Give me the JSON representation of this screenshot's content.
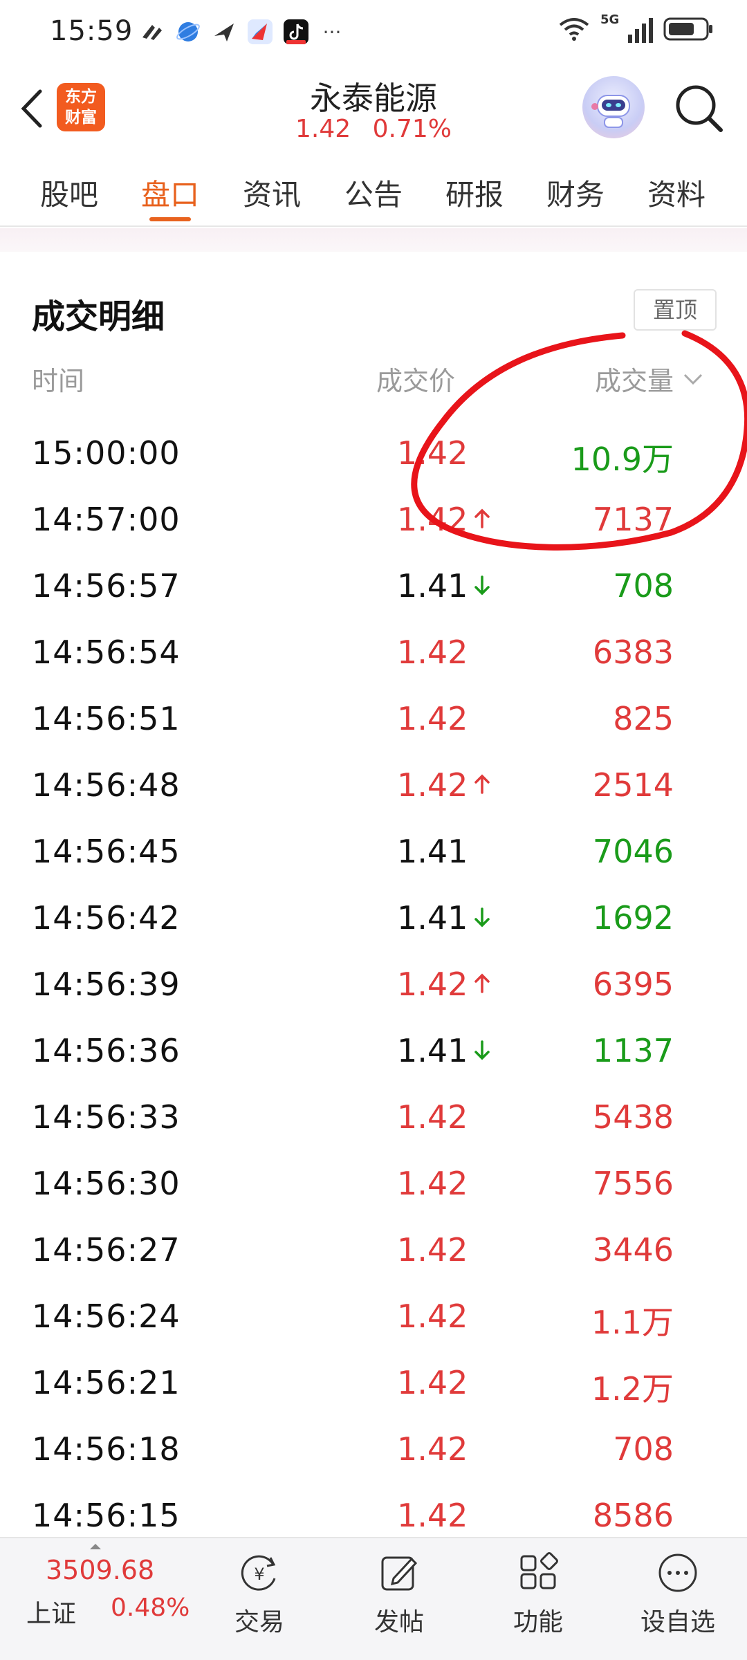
{
  "status_bar": {
    "time": "15:59",
    "more": "···",
    "network": "5G"
  },
  "header": {
    "logo_line1": "东方",
    "logo_line2": "财富",
    "title": "永泰能源",
    "price": "1.42",
    "change_pct": "0.71%"
  },
  "tabs": [
    {
      "label": "股吧"
    },
    {
      "label": "盘口"
    },
    {
      "label": "资讯"
    },
    {
      "label": "公告"
    },
    {
      "label": "研报"
    },
    {
      "label": "财务"
    },
    {
      "label": "资料"
    }
  ],
  "active_tab": "盘口",
  "section": {
    "title": "成交明细",
    "pin_label": "置顶",
    "col_time": "时间",
    "col_price": "成交价",
    "col_volume": "成交量"
  },
  "trades": [
    {
      "time": "15:00:00",
      "price": "1.42",
      "arrow": "",
      "volume": "10.9万",
      "price_color": "red",
      "vol_color": "green"
    },
    {
      "time": "14:57:00",
      "price": "1.42",
      "arrow": "up",
      "volume": "7137",
      "price_color": "red",
      "vol_color": "red"
    },
    {
      "time": "14:56:57",
      "price": "1.41",
      "arrow": "down",
      "volume": "708",
      "price_color": "dark",
      "vol_color": "green"
    },
    {
      "time": "14:56:54",
      "price": "1.42",
      "arrow": "",
      "volume": "6383",
      "price_color": "red",
      "vol_color": "red"
    },
    {
      "time": "14:56:51",
      "price": "1.42",
      "arrow": "",
      "volume": "825",
      "price_color": "red",
      "vol_color": "red"
    },
    {
      "time": "14:56:48",
      "price": "1.42",
      "arrow": "up",
      "volume": "2514",
      "price_color": "red",
      "vol_color": "red"
    },
    {
      "time": "14:56:45",
      "price": "1.41",
      "arrow": "",
      "volume": "7046",
      "price_color": "dark",
      "vol_color": "green"
    },
    {
      "time": "14:56:42",
      "price": "1.41",
      "arrow": "down",
      "volume": "1692",
      "price_color": "dark",
      "vol_color": "green"
    },
    {
      "time": "14:56:39",
      "price": "1.42",
      "arrow": "up",
      "volume": "6395",
      "price_color": "red",
      "vol_color": "red"
    },
    {
      "time": "14:56:36",
      "price": "1.41",
      "arrow": "down",
      "volume": "1137",
      "price_color": "dark",
      "vol_color": "green"
    },
    {
      "time": "14:56:33",
      "price": "1.42",
      "arrow": "",
      "volume": "5438",
      "price_color": "red",
      "vol_color": "red"
    },
    {
      "time": "14:56:30",
      "price": "1.42",
      "arrow": "",
      "volume": "7556",
      "price_color": "red",
      "vol_color": "red"
    },
    {
      "time": "14:56:27",
      "price": "1.42",
      "arrow": "",
      "volume": "3446",
      "price_color": "red",
      "vol_color": "red"
    },
    {
      "time": "14:56:24",
      "price": "1.42",
      "arrow": "",
      "volume": "1.1万",
      "price_color": "red",
      "vol_color": "red"
    },
    {
      "time": "14:56:21",
      "price": "1.42",
      "arrow": "",
      "volume": "1.2万",
      "price_color": "red",
      "vol_color": "red"
    },
    {
      "time": "14:56:18",
      "price": "1.42",
      "arrow": "",
      "volume": "708",
      "price_color": "red",
      "vol_color": "red"
    },
    {
      "time": "14:56:15",
      "price": "1.42",
      "arrow": "",
      "volume": "8586",
      "price_color": "red",
      "vol_color": "red"
    }
  ],
  "bottom_bar": {
    "index_value": "3509.68",
    "index_name": "上证",
    "index_pct": "0.48%",
    "items": [
      {
        "label": "交易",
        "icon": "trade-yen-icon"
      },
      {
        "label": "发帖",
        "icon": "post-edit-icon"
      },
      {
        "label": "功能",
        "icon": "functions-grid-icon"
      },
      {
        "label": "设自选",
        "icon": "more-circle-icon"
      }
    ]
  },
  "colors": {
    "accent": "#e8621e",
    "up": "#e03a3a",
    "down": "#1a9b1a",
    "annotation": "#e8141a"
  }
}
